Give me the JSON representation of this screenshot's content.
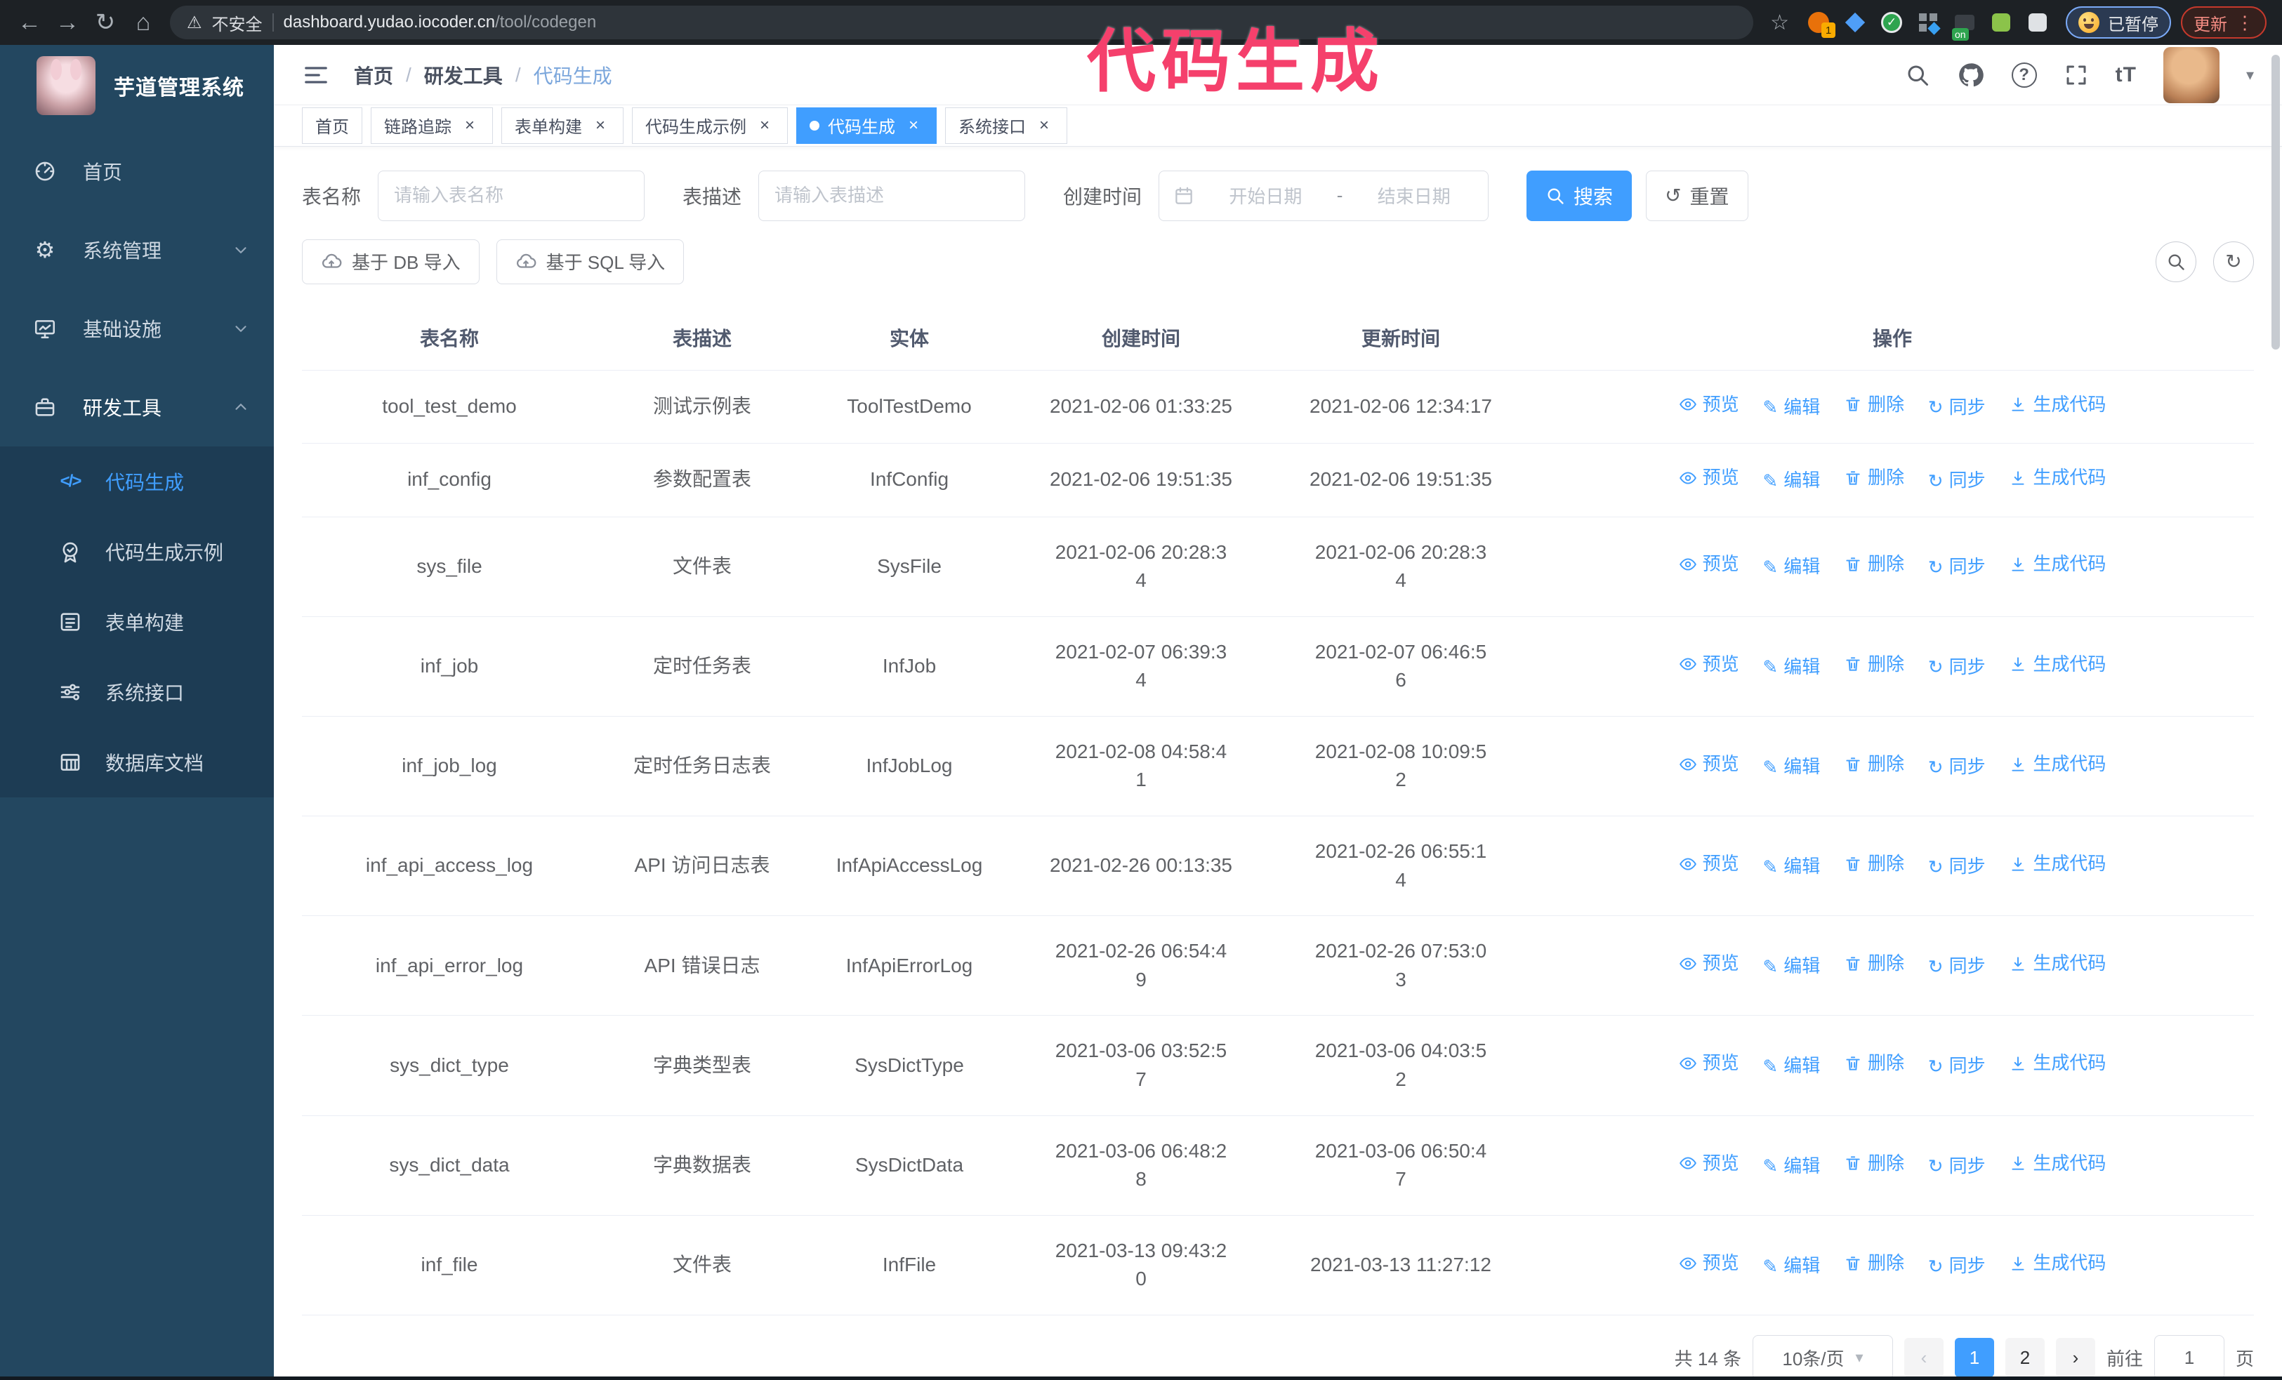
{
  "theme": {
    "accent": "#409eff",
    "sidebar_bg": "#234760",
    "submenu_bg": "#1d3c54",
    "annotation_color": "#f5406c"
  },
  "browser": {
    "security_label": "不安全",
    "url_host": "dashboard.yudao.iocoder.cn",
    "url_path": "/tool/codegen",
    "ext_badge_1": "1",
    "ext_badge_on": "on",
    "paused_label": "已暂停",
    "update_label": "更新"
  },
  "annotation": {
    "text": "代码生成"
  },
  "sidebar": {
    "title": "芋道管理系统",
    "items": [
      {
        "label": "首页"
      },
      {
        "label": "系统管理"
      },
      {
        "label": "基础设施"
      },
      {
        "label": "研发工具"
      }
    ],
    "subitems": [
      {
        "label": "代码生成"
      },
      {
        "label": "代码生成示例"
      },
      {
        "label": "表单构建"
      },
      {
        "label": "系统接口"
      },
      {
        "label": "数据库文档"
      }
    ]
  },
  "navbar": {
    "breadcrumb": [
      "首页",
      "研发工具",
      "代码生成"
    ]
  },
  "tags": [
    {
      "label": "首页"
    },
    {
      "label": "链路追踪"
    },
    {
      "label": "表单构建"
    },
    {
      "label": "代码生成示例"
    },
    {
      "label": "代码生成"
    },
    {
      "label": "系统接口"
    }
  ],
  "filters": {
    "table_name_label": "表名称",
    "table_name_placeholder": "请输入表名称",
    "table_desc_label": "表描述",
    "table_desc_placeholder": "请输入表描述",
    "create_time_label": "创建时间",
    "start_placeholder": "开始日期",
    "range_separator": "-",
    "end_placeholder": "结束日期",
    "search_label": "搜索",
    "reset_label": "重置"
  },
  "toolbar": {
    "import_db_label": "基于 DB 导入",
    "import_sql_label": "基于 SQL 导入"
  },
  "table": {
    "columns": [
      "表名称",
      "表描述",
      "实体",
      "创建时间",
      "更新时间",
      "操作"
    ],
    "actions": [
      "预览",
      "编辑",
      "删除",
      "同步",
      "生成代码"
    ],
    "rows": [
      {
        "name": "tool_test_demo",
        "description": "测试示例表",
        "entity": "ToolTestDemo",
        "create_time": "2021-02-06 01:33:25",
        "update_time": "2021-02-06 12:34:17"
      },
      {
        "name": "inf_config",
        "description": "参数配置表",
        "entity": "InfConfig",
        "create_time": "2021-02-06 19:51:35",
        "update_time": "2021-02-06 19:51:35"
      },
      {
        "name": "sys_file",
        "description": "文件表",
        "entity": "SysFile",
        "create_time": "2021-02-06 20:28:3\n4",
        "update_time": "2021-02-06 20:28:3\n4"
      },
      {
        "name": "inf_job",
        "description": "定时任务表",
        "entity": "InfJob",
        "create_time": "2021-02-07 06:39:3\n4",
        "update_time": "2021-02-07 06:46:5\n6"
      },
      {
        "name": "inf_job_log",
        "description": "定时任务日志表",
        "entity": "InfJobLog",
        "create_time": "2021-02-08 04:58:4\n1",
        "update_time": "2021-02-08 10:09:5\n2"
      },
      {
        "name": "inf_api_access_log",
        "description": "API 访问日志表",
        "entity": "InfApiAccessLog",
        "create_time": "2021-02-26 00:13:35",
        "update_time": "2021-02-26 06:55:1\n4"
      },
      {
        "name": "inf_api_error_log",
        "description": "API 错误日志",
        "entity": "InfApiErrorLog",
        "create_time": "2021-02-26 06:54:4\n9",
        "update_time": "2021-02-26 07:53:0\n3"
      },
      {
        "name": "sys_dict_type",
        "description": "字典类型表",
        "entity": "SysDictType",
        "create_time": "2021-03-06 03:52:5\n7",
        "update_time": "2021-03-06 04:03:5\n2"
      },
      {
        "name": "sys_dict_data",
        "description": "字典数据表",
        "entity": "SysDictData",
        "create_time": "2021-03-06 06:48:2\n8",
        "update_time": "2021-03-06 06:50:4\n7"
      },
      {
        "name": "inf_file",
        "description": "文件表",
        "entity": "InfFile",
        "create_time": "2021-03-13 09:43:2\n0",
        "update_time": "2021-03-13 11:27:12"
      }
    ]
  },
  "pagination": {
    "total": "共 14 条",
    "page_size": "10条/页",
    "pages": [
      "1",
      "2"
    ],
    "goto_label": "前往",
    "goto_value": "1",
    "unit_label": "页"
  },
  "icons": {
    "close": "×",
    "breadcrumb_separator": "/",
    "caret_down": "▾",
    "kebab": "⋮",
    "warning": "⚠",
    "star": "☆",
    "back": "←",
    "forward": "→",
    "reload": "↻",
    "home": "⌂",
    "gear": "⚙",
    "code": "</>",
    "font_size": "tT",
    "question": "?",
    "chevron_left": "‹",
    "chevron_right": "›",
    "pen": "✎",
    "sync": "↻",
    "reset": "↺",
    "check": "✓"
  }
}
